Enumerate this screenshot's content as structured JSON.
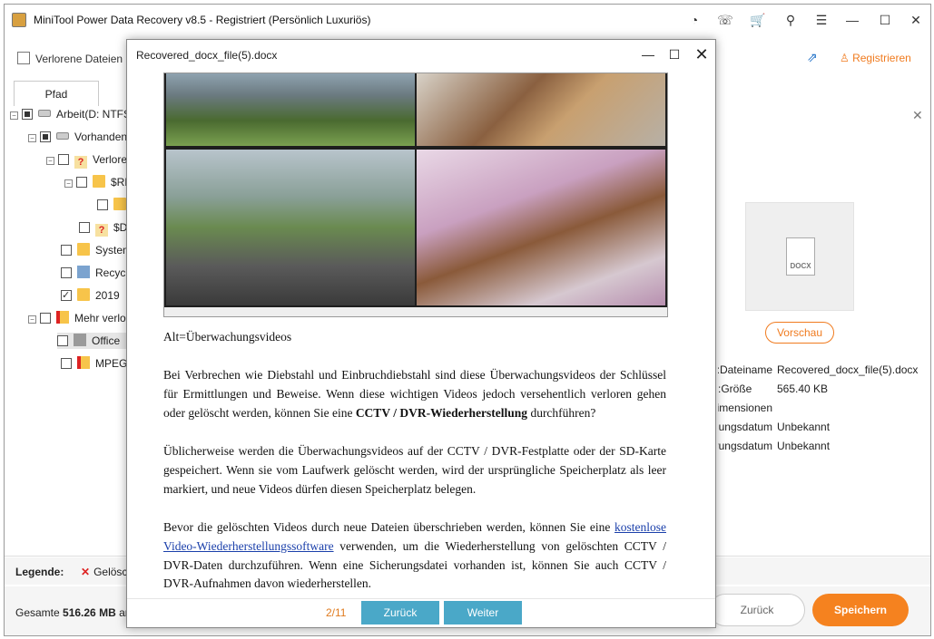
{
  "app": {
    "title": "MiniTool Power Data Recovery v8.5 - Registriert (Persönlich Luxuriös)",
    "register_label": "Registrieren",
    "lost_files_label": "Verlorene Dateien"
  },
  "tree": {
    "tab_label": "Pfad",
    "items": [
      {
        "label": "Arbeit(D: NTFS)",
        "check": "partial"
      },
      {
        "label": "Vorhandene Partition",
        "check": "partial"
      },
      {
        "label": "Verlorene Dateien",
        "check": "none"
      },
      {
        "label": "$RECYCLE.BIN",
        "check": "none"
      },
      {
        "label": "",
        "check": "none"
      },
      {
        "label": "$DATA",
        "check": "none"
      },
      {
        "label": "System Volume Information",
        "check": "none"
      },
      {
        "label": "Recycled",
        "check": "none"
      },
      {
        "label": "2019",
        "check": "checked"
      },
      {
        "label": "Mehr verlorene Dateien",
        "check": "none"
      },
      {
        "label": "Office",
        "check": "none"
      },
      {
        "label": "MPEG",
        "check": "none"
      }
    ]
  },
  "details": {
    "thumb_label": "DOCX",
    "preview_label": "Vorschau",
    "props": [
      {
        "label": "Dateiname:",
        "value": "Recovered_docx_file(5).docx"
      },
      {
        "label": "Größe:",
        "value": "565.40 KB"
      },
      {
        "label": "Dimensionen:",
        "value": ""
      },
      {
        "label": "Erstellungsdatum:",
        "value": "Unbekannt"
      },
      {
        "label": "Änderungsdatum:",
        "value": "Unbekannt"
      }
    ]
  },
  "legend": {
    "label": "Legende:",
    "deleted_label": "Gelöscht"
  },
  "status": {
    "total_prefix": "Gesamte ",
    "total_size": "516.26 MB",
    "total_suffix": " an",
    "back_label": "Zurück",
    "save_label": "Speichern"
  },
  "preview": {
    "title": "Recovered_docx_file(5).docx",
    "alt_text": "Alt=Überwachungsvideos",
    "para1_a": "Bei Verbrechen wie Diebstahl und Einbruchdiebstahl sind diese Überwachungsvideos der Schlüssel für Ermittlungen und Beweise. Wenn diese wichtigen Videos jedoch versehentlich verloren gehen oder gelöscht werden, können Sie eine ",
    "para1_bold": "CCTV / DVR-Wiederherstellung",
    "para1_b": " durchführen?",
    "para2": "Üblicherweise werden die Überwachungsvideos auf der CCTV / DVR-Festplatte oder der SD-Karte gespeichert. Wenn sie vom Laufwerk gelöscht werden, wird der ursprüngliche Speicherplatz als leer markiert, und neue Videos dürfen diesen Speicherplatz belegen.",
    "para3_a": "Bevor die gelöschten Videos durch neue Dateien überschrieben werden, können Sie eine ",
    "para3_link": "kostenlose Video-Wiederherstellungssoftware",
    "para3_b": " verwenden, um die Wiederherstellung von gelöschten CCTV / DVR-Daten durchzuführen. Wenn eine Sicherungsdatei vorhanden ist, können Sie auch CCTV / DVR-Aufnahmen davon wiederherstellen.",
    "page_indicator": "2/11",
    "prev_label": "Zurück",
    "next_label": "Weiter"
  },
  "icons": {
    "accent": "#f5821f",
    "button_blue": "#4aa8c8"
  }
}
